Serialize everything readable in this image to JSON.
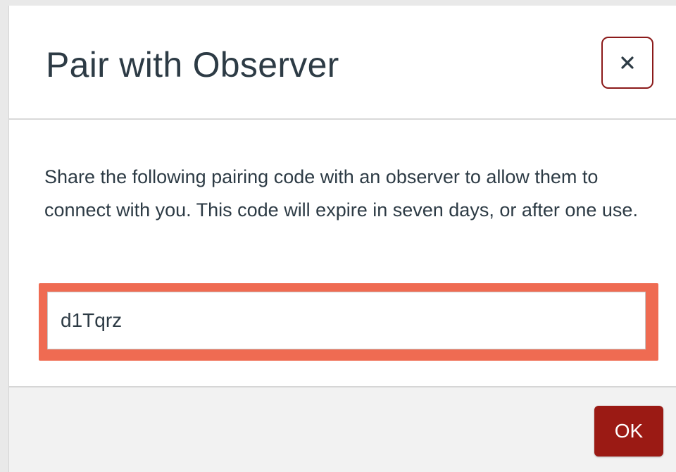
{
  "dialog": {
    "title": "Pair with Observer",
    "close_icon": "close-icon",
    "description": "Share the following pairing code with an observer to allow them to connect with you. This code will expire in seven days, or after one use.",
    "pairing_code": "d1Tqrz",
    "ok_label": "OK"
  },
  "colors": {
    "title_text": "#2d3b45",
    "close_border": "#8b1a1a",
    "highlight": "#ef6b52",
    "ok_button": "#9b1a14",
    "footer_bg": "#f2f2f2"
  }
}
